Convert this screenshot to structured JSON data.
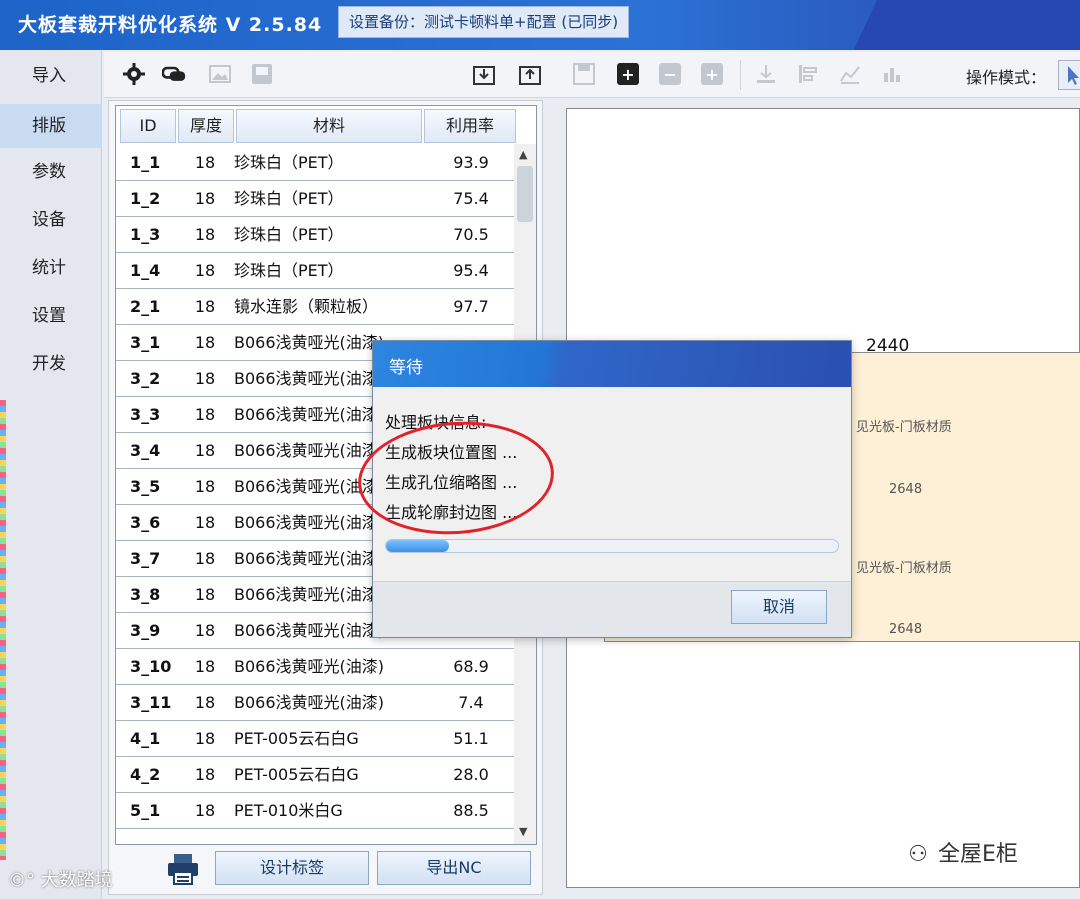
{
  "app": {
    "title": "大板套裁开料优化系统  V 2.5.84",
    "backup_badge": "设置备份：测试卡顿料单+配置 (已同步)"
  },
  "nav": {
    "items": [
      {
        "label": "导入"
      },
      {
        "label": "排版",
        "active": true
      },
      {
        "label": "参数"
      },
      {
        "label": "设备"
      },
      {
        "label": "统计"
      },
      {
        "label": "设置"
      },
      {
        "label": "开发"
      }
    ]
  },
  "toolbar": {
    "icons": [
      "gear-icon",
      "link-icon",
      "image-icon",
      "save-image-icon",
      "download-icon",
      "upload-icon",
      "save-icon",
      "plus-icon",
      "minus-icon",
      "add-box-icon",
      "align-bottom-icon",
      "align-left-icon",
      "chart-icon",
      "bar-chart-icon"
    ],
    "mode_label": "操作模式："
  },
  "table": {
    "headers": [
      "ID",
      "厚度",
      "材料",
      "利用率"
    ],
    "rows": [
      {
        "id": "1_1",
        "thickness": "18",
        "material": "珍珠白（PET）",
        "rate": "93.9"
      },
      {
        "id": "1_2",
        "thickness": "18",
        "material": "珍珠白（PET）",
        "rate": "75.4"
      },
      {
        "id": "1_3",
        "thickness": "18",
        "material": "珍珠白（PET）",
        "rate": "70.5"
      },
      {
        "id": "1_4",
        "thickness": "18",
        "material": "珍珠白（PET）",
        "rate": "95.4"
      },
      {
        "id": "2_1",
        "thickness": "18",
        "material": "镜水连影（颗粒板）",
        "rate": "97.7"
      },
      {
        "id": "3_1",
        "thickness": "18",
        "material": "B066浅黄哑光(油漆)",
        "rate": ""
      },
      {
        "id": "3_2",
        "thickness": "18",
        "material": "B066浅黄哑光(油漆)",
        "rate": ""
      },
      {
        "id": "3_3",
        "thickness": "18",
        "material": "B066浅黄哑光(油漆)",
        "rate": ""
      },
      {
        "id": "3_4",
        "thickness": "18",
        "material": "B066浅黄哑光(油漆)",
        "rate": ""
      },
      {
        "id": "3_5",
        "thickness": "18",
        "material": "B066浅黄哑光(油漆)",
        "rate": ""
      },
      {
        "id": "3_6",
        "thickness": "18",
        "material": "B066浅黄哑光(油漆)",
        "rate": ""
      },
      {
        "id": "3_7",
        "thickness": "18",
        "material": "B066浅黄哑光(油漆)",
        "rate": ""
      },
      {
        "id": "3_8",
        "thickness": "18",
        "material": "B066浅黄哑光(油漆)",
        "rate": ""
      },
      {
        "id": "3_9",
        "thickness": "18",
        "material": "B066浅黄哑光(油漆)",
        "rate": ""
      },
      {
        "id": "3_10",
        "thickness": "18",
        "material": "B066浅黄哑光(油漆)",
        "rate": "68.9"
      },
      {
        "id": "3_11",
        "thickness": "18",
        "material": "B066浅黄哑光(油漆)",
        "rate": "7.4"
      },
      {
        "id": "4_1",
        "thickness": "18",
        "material": "PET-005云石白G",
        "rate": "51.1"
      },
      {
        "id": "4_2",
        "thickness": "18",
        "material": "PET-005云石白G",
        "rate": "28.0"
      },
      {
        "id": "5_1",
        "thickness": "18",
        "material": "PET-010米白G",
        "rate": "88.5"
      }
    ]
  },
  "buttons": {
    "design_label": "设计标签",
    "export_nc": "导出NC"
  },
  "drawing": {
    "width_label": "2440",
    "part1_name": "见光板-门板材质",
    "part1_dim": "2648",
    "part2_name": "见光板-门板材质",
    "part2_dim": "2648"
  },
  "dialog": {
    "title": "等待",
    "lines": [
      "处理板块信息:",
      "生成板块位置图 ...",
      "生成孔位缩略图 ...",
      "生成轮廓封边图 ..."
    ],
    "progress": 0.14,
    "cancel_label": "取消"
  },
  "watermark": {
    "left": "大数踏境",
    "right": "全屋E柜"
  }
}
